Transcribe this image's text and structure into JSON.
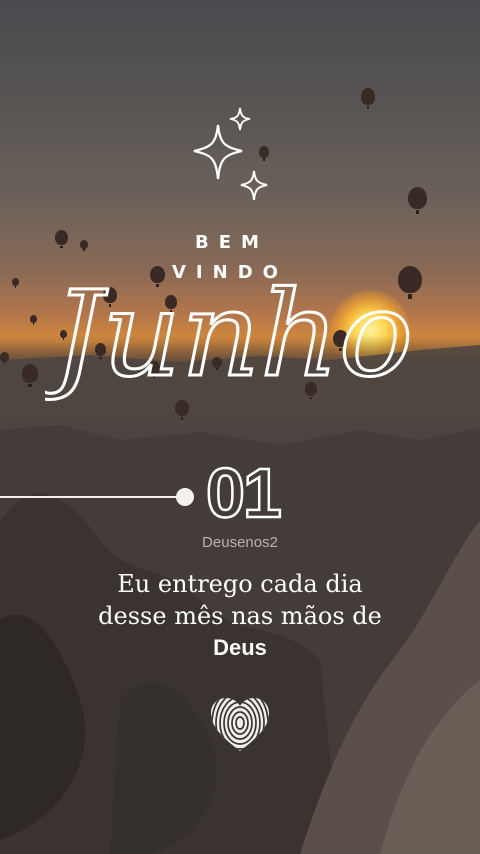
{
  "greeting": {
    "line1": "BEM",
    "line2": "VINDO",
    "month": "Junho"
  },
  "day_number": "01",
  "handle": "Deusenos2",
  "message": {
    "line1": "Eu entrego cada dia",
    "line2": "desse mês nas mãos de",
    "emphasis": "Deus"
  },
  "icons": {
    "sparkles": "sparkle-stars-icon",
    "fingerprint_heart": "heart-fingerprint-icon"
  },
  "colors": {
    "text": "#ffffff",
    "handle": "#b8b2ac",
    "sun": "#ffd34d",
    "sky_top": "#4a4b4f",
    "horizon": "#d48a3c"
  }
}
